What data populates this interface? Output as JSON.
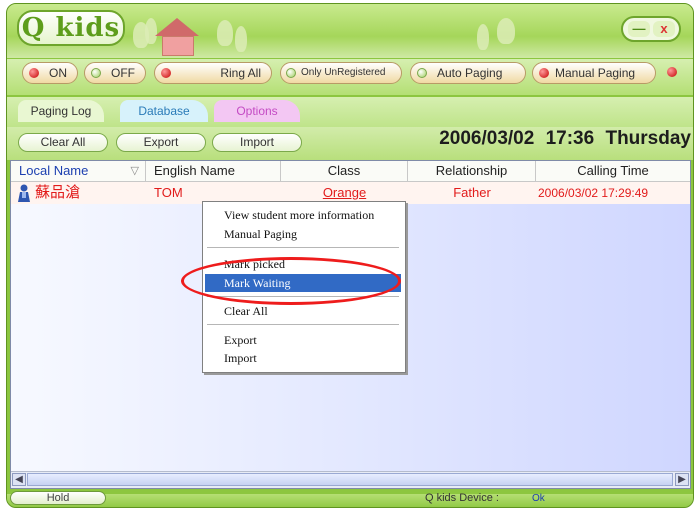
{
  "app": {
    "title": "Q kids"
  },
  "window_controls": {
    "minimize": "—",
    "close": "x"
  },
  "toolbar": {
    "buttons": [
      {
        "label": "ON",
        "dot": "red"
      },
      {
        "label": "OFF",
        "dot": "green"
      },
      {
        "label": "Ring All",
        "dot": "red"
      },
      {
        "label": "Only UnRegistered",
        "dot": "green"
      },
      {
        "label": "Auto Paging",
        "dot": "green"
      },
      {
        "label": "Manual Paging",
        "dot": "red"
      }
    ]
  },
  "tabs": [
    {
      "label": "Paging Log",
      "active": true
    },
    {
      "label": "Database",
      "active": false
    },
    {
      "label": "Options",
      "active": false
    }
  ],
  "actions": {
    "clear_all": "Clear All",
    "export": "Export",
    "import": "Import"
  },
  "datetime": {
    "date": "2006/03/02",
    "time": "17:36",
    "day": "Thursday"
  },
  "table": {
    "columns": [
      "Local Name",
      "English Name",
      "Class",
      "Relationship",
      "Calling Time"
    ],
    "rows": [
      {
        "local_name": "蘇品滄",
        "english_name": "TOM",
        "class": "Orange",
        "relationship": "Father",
        "calling_time": "2006/03/02 17:29:49"
      }
    ]
  },
  "context_menu": {
    "items": [
      {
        "label": "View student more information",
        "selected": false
      },
      {
        "label": "Manual Paging",
        "selected": false
      },
      {
        "label": "Mark picked",
        "selected": false
      },
      {
        "label": "Mark Waiting",
        "selected": true
      },
      {
        "label": "Clear All",
        "selected": false
      },
      {
        "label": "Export",
        "selected": false
      },
      {
        "label": "Import",
        "selected": false
      }
    ]
  },
  "status": {
    "hold": "Hold",
    "device_label": "Q kids Device :",
    "device_status": "Ok"
  },
  "colors": {
    "frame": "#8cc63f",
    "highlight": "#316ac5",
    "annotation": "#ee1c1c",
    "row_text": "#e21b1b"
  }
}
